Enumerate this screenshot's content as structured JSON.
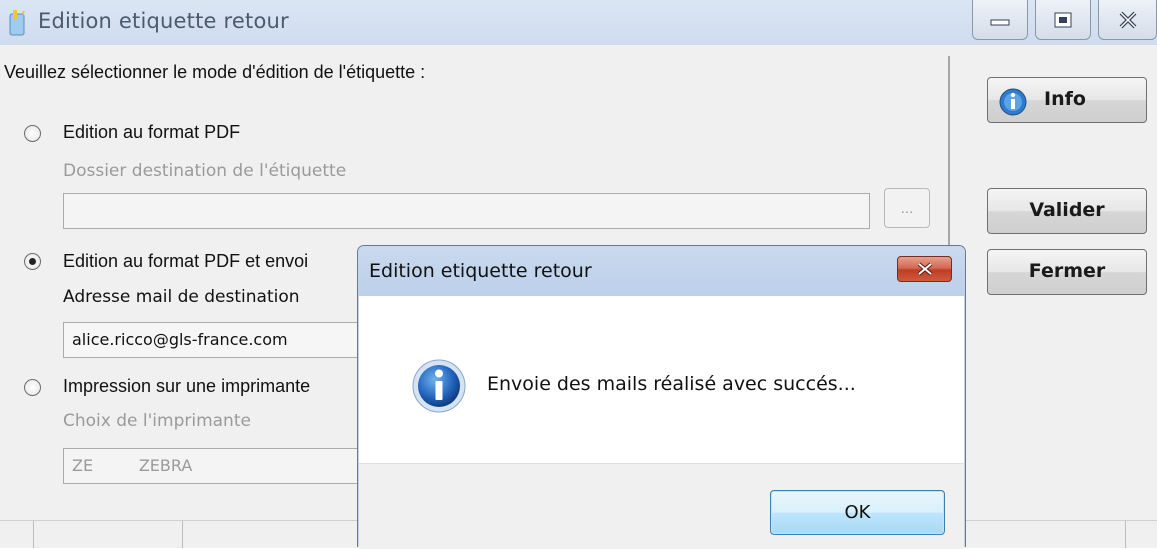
{
  "window": {
    "title": "Edition etiquette retour",
    "intro": "Veuillez sélectionner le mode d'édition de l'étiquette :"
  },
  "options": {
    "pdf": {
      "label": "Edition au format PDF",
      "selected": false,
      "sub_label": "Dossier destination de l'étiquette",
      "value": "",
      "browse": "..."
    },
    "pdf_mail": {
      "label": "Edition au format PDF et envoi",
      "selected": true,
      "sub_label": "Adresse mail de destination",
      "value": "alice.ricco@gls-france.com"
    },
    "printer": {
      "label": "Impression sur une imprimante",
      "selected": false,
      "sub_label": "Choix de l'imprimante",
      "value": "ZE         ZEBRA"
    }
  },
  "side_buttons": {
    "info": "Info",
    "valider": "Valider",
    "fermer": "Fermer"
  },
  "dialog": {
    "title": "Edition etiquette retour",
    "message": "Envoie des mails réalisé avec succés...",
    "ok": "OK"
  },
  "colors": {
    "titlebar": "#cfdcee",
    "dialog_titlebar": "#bcd0ea",
    "close_red": "#c03d24",
    "ok_border": "#3c7fb1"
  }
}
